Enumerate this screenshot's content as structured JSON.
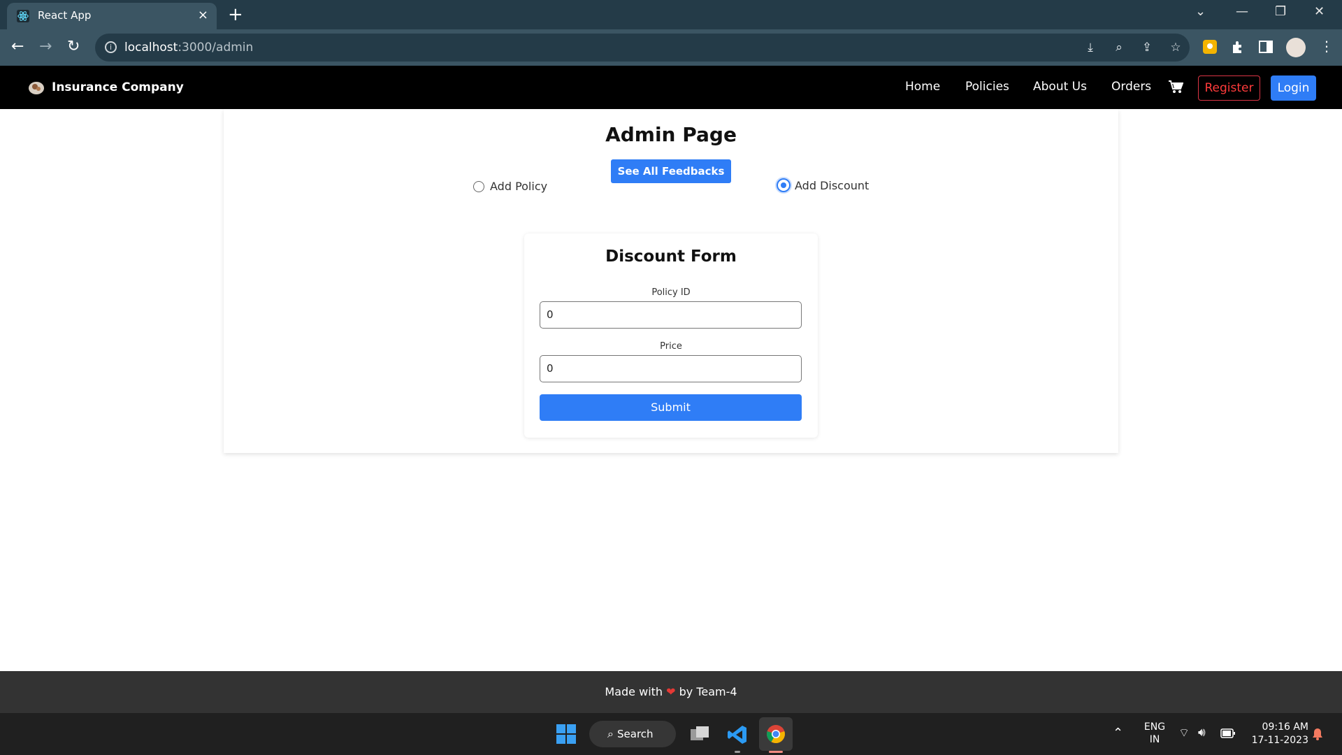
{
  "browser": {
    "tab_title": "React App",
    "tab_close": "×",
    "new_tab": "+",
    "url_host": "localhost",
    "url_path": ":3000/admin"
  },
  "navbar": {
    "brand": "Insurance Company",
    "links": [
      "Home",
      "Policies",
      "About Us",
      "Orders"
    ],
    "register": "Register",
    "login": "Login"
  },
  "admin": {
    "title": "Admin Page",
    "feedback_button": "See All Feedbacks",
    "radio_add_policy": "Add Policy",
    "radio_add_discount": "Add Discount",
    "selected": "Add Discount"
  },
  "form": {
    "title": "Discount Form",
    "policy_id_label": "Policy ID",
    "policy_id_value": "0",
    "price_label": "Price",
    "price_value": "0",
    "submit": "Submit"
  },
  "footer": {
    "made_with": "Made with",
    "by": "by Team-4"
  },
  "taskbar": {
    "search": "Search",
    "lang_top": "ENG",
    "lang_bottom": "IN",
    "time": "09:16 AM",
    "date": "17-11-2023"
  },
  "colors": {
    "primary": "#2f7df6",
    "danger": "#dc3545",
    "navbar_bg": "#000000",
    "footer_bg": "#333333"
  }
}
